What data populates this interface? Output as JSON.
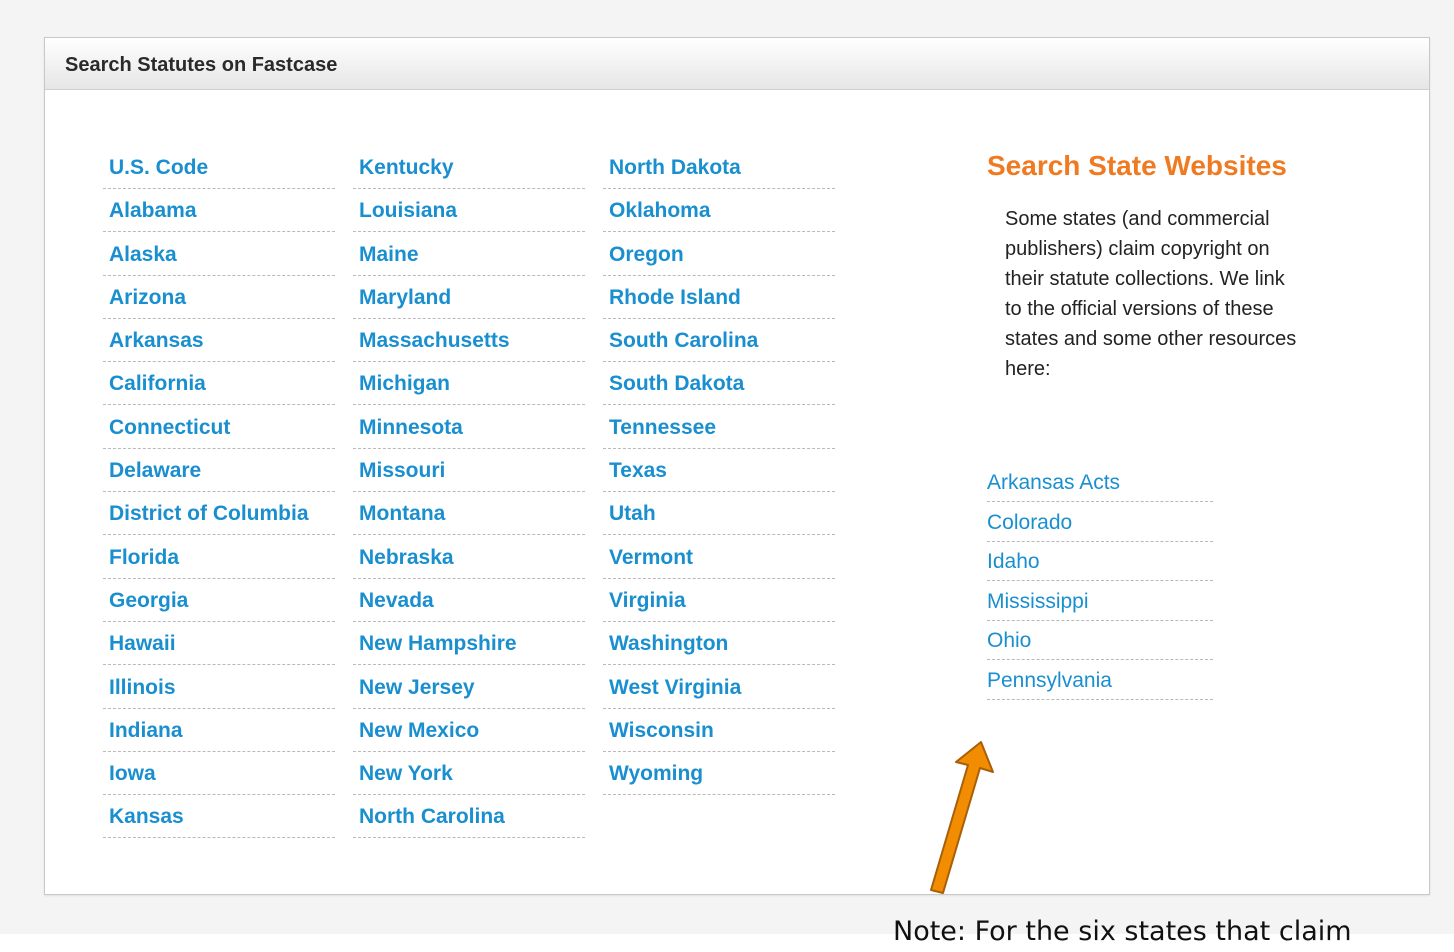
{
  "panel": {
    "title": "Search Statutes on Fastcase"
  },
  "states": {
    "col1": [
      "U.S. Code",
      "Alabama",
      "Alaska",
      "Arizona",
      "Arkansas",
      "California",
      "Connecticut",
      "Delaware",
      "District of Columbia",
      "Florida",
      "Georgia",
      "Hawaii",
      "Illinois",
      "Indiana",
      "Iowa",
      "Kansas"
    ],
    "col2": [
      "Kentucky",
      "Louisiana",
      "Maine",
      "Maryland",
      "Massachusetts",
      "Michigan",
      "Minnesota",
      "Missouri",
      "Montana",
      "Nebraska",
      "Nevada",
      "New Hampshire",
      "New Jersey",
      "New Mexico",
      "New York",
      "North Carolina"
    ],
    "col3": [
      "North Dakota",
      "Oklahoma",
      "Oregon",
      "Rhode Island",
      "South Carolina",
      "South Dakota",
      "Tennessee",
      "Texas",
      "Utah",
      "Vermont",
      "Virginia",
      "Washington",
      "West Virginia",
      "Wisconsin",
      "Wyoming"
    ]
  },
  "side": {
    "title": "Search State Websites",
    "text": "Some states (and commercial publishers) claim copyright on their statute collections. We link to the official versions of these states and some other resources here:",
    "links": [
      "Arkansas Acts",
      "Colorado",
      "Idaho",
      "Mississippi",
      "Ohio",
      "Pennsylvania"
    ]
  },
  "annotation": {
    "note": "Note: For the six states that claim",
    "arrow_icon": "arrow-up-icon",
    "arrow_color": "#f28c00"
  },
  "colors": {
    "link": "#1a8fd0",
    "accent": "#f07a21"
  }
}
